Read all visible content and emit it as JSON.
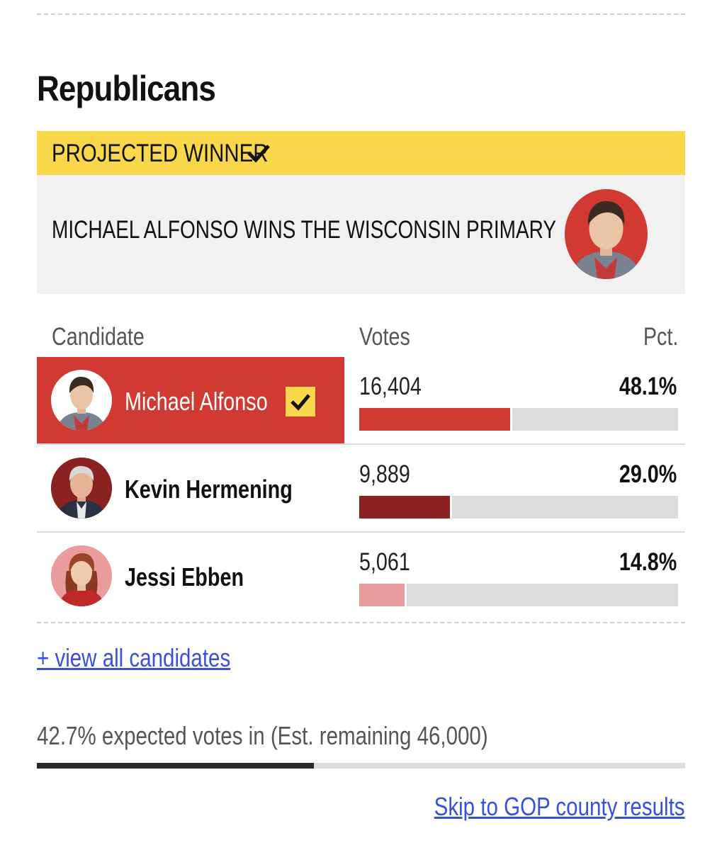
{
  "section_title": "Republicans",
  "winner_banner": {
    "label": "PROJECTED WINNER",
    "headline": "MICHAEL ALFONSO WINS THE WISCONSIN PRIMARY"
  },
  "table": {
    "headers": {
      "candidate": "Candidate",
      "votes": "Votes",
      "pct": "Pct."
    },
    "rows": [
      {
        "name": "Michael Alfonso",
        "votes": "16,404",
        "pct": "48.1%",
        "share": 0.481,
        "winner": true,
        "color": "#d03a33"
      },
      {
        "name": "Kevin Hermening",
        "votes": "9,889",
        "pct": "29.0%",
        "share": 0.29,
        "winner": false,
        "color": "#8a2222"
      },
      {
        "name": "Jessi Ebben",
        "votes": "5,061",
        "pct": "14.8%",
        "share": 0.148,
        "winner": false,
        "color": "#ea9b9b"
      }
    ]
  },
  "view_all_link": "+ view all candidates",
  "expected_votes": {
    "text": "42.7% expected votes in (Est. remaining 46,000)",
    "fraction": 0.427
  },
  "skip_link": "Skip to GOP county results",
  "colors": {
    "accent_yellow": "#f8d84a",
    "winner_red": "#d03a33",
    "link_blue": "#3a50d8"
  }
}
